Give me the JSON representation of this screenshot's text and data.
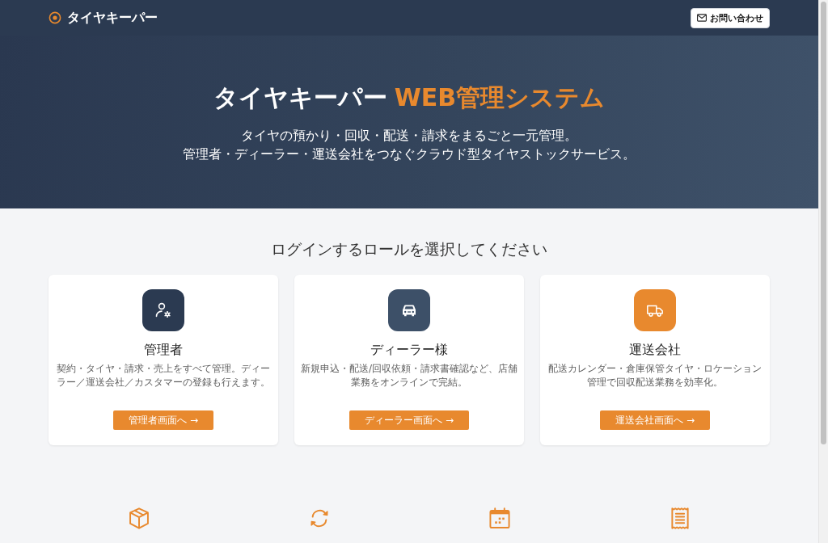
{
  "header": {
    "brand": "タイヤキーパー",
    "contact_button": "お問い合わせ"
  },
  "hero": {
    "title": "タイヤキーパー",
    "title_accent": "WEB管理システム",
    "lines": [
      "タイヤの預かり・回収・配送・請求をまるごと一元管理。",
      "管理者・ディーラー・運送会社をつなぐクラウド型タイヤストックサービス。"
    ]
  },
  "role_prompt": "ログインするロールを選択してください",
  "roles": [
    {
      "kind": "admin",
      "color": "#2b3a51",
      "title": "管理者",
      "description": "契約・タイヤ・請求・売上をすべて管理。ディーラー／運送会社／カスタマーの登録も行えます。",
      "button": "管理者画面へ →"
    },
    {
      "kind": "dealer",
      "color": "#3d5068",
      "title": "ディーラー様",
      "description": "新規申込・配送/回収依頼・請求書確認など、店舗業務をオンラインで完結。",
      "button": "ディーラー画面へ →"
    },
    {
      "kind": "carrier",
      "color": "#e8892e",
      "title": "運送会社",
      "description": "配送カレンダー・倉庫保管タイヤ・ロケーション管理で回収配送業務を効率化。",
      "button": "運送会社画面へ →"
    }
  ],
  "features": [
    {
      "kind": "box"
    },
    {
      "kind": "sync"
    },
    {
      "kind": "calendar"
    },
    {
      "kind": "receipt"
    }
  ]
}
